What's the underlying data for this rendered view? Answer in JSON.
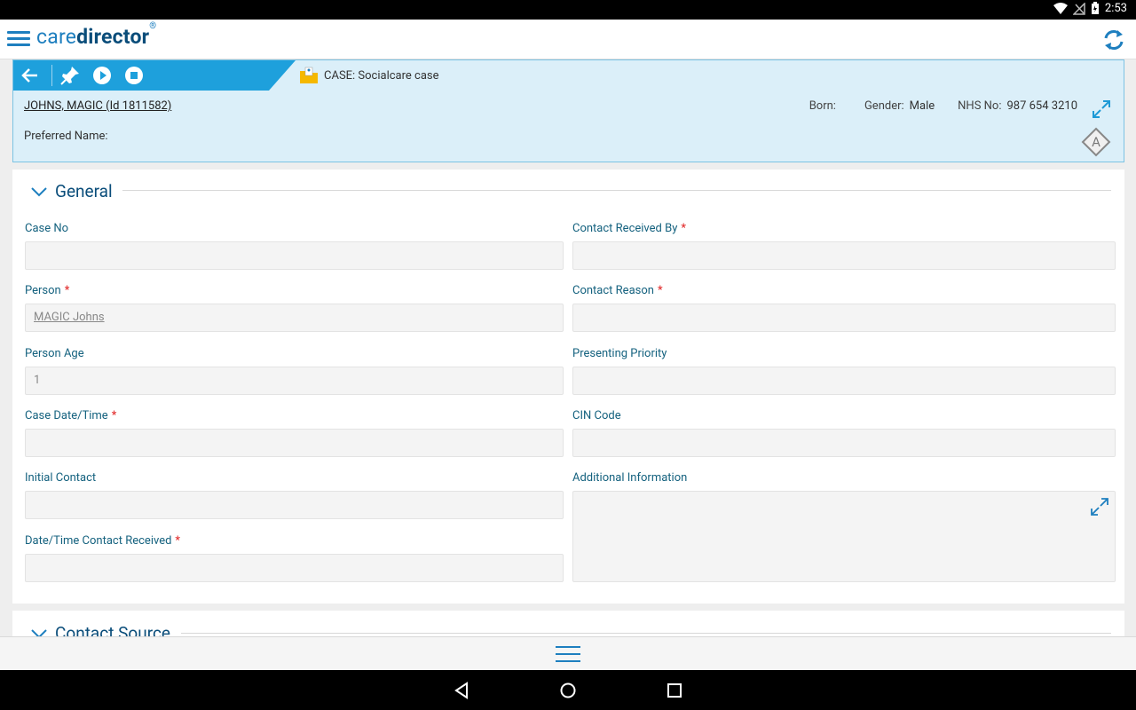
{
  "status_bar": {
    "time": "2:53"
  },
  "app_bar": {
    "logo_care": "care",
    "logo_director": "director",
    "logo_mark": "®"
  },
  "case_header": {
    "title": "CASE: Socialcare case",
    "patient_name": "JOHNS, MAGIC (Id 1811582)",
    "preferred_name_label": "Preferred Name:",
    "born_label": "Born:",
    "born_value": "",
    "gender_label": "Gender:",
    "gender_value": "Male",
    "nhs_label": "NHS No:",
    "nhs_value": "987 654 3210",
    "alert_letter": "A"
  },
  "general": {
    "title": "General",
    "fields": {
      "case_no": {
        "label": "Case No",
        "value": ""
      },
      "person": {
        "label": "Person",
        "value": "MAGIC Johns"
      },
      "person_age": {
        "label": "Person Age",
        "value": "1"
      },
      "case_datetime": {
        "label": "Case Date/Time",
        "value": ""
      },
      "initial_contact": {
        "label": "Initial Contact",
        "value": ""
      },
      "datetime_contact_received": {
        "label": "Date/Time Contact Received",
        "value": ""
      },
      "contact_received_by": {
        "label": "Contact Received By",
        "value": ""
      },
      "contact_reason": {
        "label": "Contact Reason",
        "value": ""
      },
      "presenting_priority": {
        "label": "Presenting Priority",
        "value": ""
      },
      "cin_code": {
        "label": "CIN Code",
        "value": ""
      },
      "additional_information": {
        "label": "Additional Information",
        "value": ""
      }
    },
    "required_marker": "*"
  },
  "contact_source": {
    "title": "Contact Source"
  },
  "colors": {
    "accent": "#1e7fbf",
    "brand_dark": "#0a4d7a",
    "header_bg": "#dbeff9",
    "required": "#e02020"
  }
}
